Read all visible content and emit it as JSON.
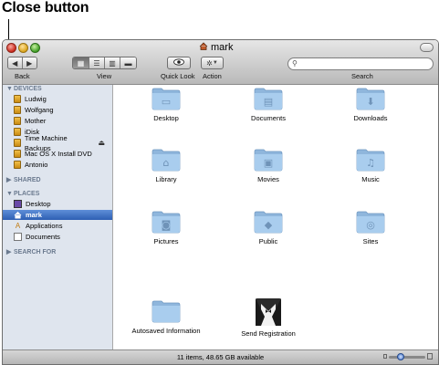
{
  "annotation": {
    "label": "Close button"
  },
  "window": {
    "title": "mark"
  },
  "toolbar": {
    "back_label": "Back",
    "view_label": "View",
    "quicklook_label": "Quick Look",
    "action_label": "Action",
    "search_label": "Search",
    "search_placeholder": ""
  },
  "sidebar": {
    "devices_header": "DEVICES",
    "devices": [
      "Ludwig",
      "Wolfgang",
      "Mother",
      "iDisk",
      "Time Machine Backups",
      "Mac OS X Install DVD",
      "Antonio"
    ],
    "shared_header": "SHARED",
    "places_header": "PLACES",
    "places": [
      "Desktop",
      "mark",
      "Applications",
      "Documents"
    ],
    "search_header": "SEARCH FOR"
  },
  "folders": [
    {
      "name": "Desktop",
      "icon": "desktop-folder-icon"
    },
    {
      "name": "Documents",
      "icon": "documents-folder-icon"
    },
    {
      "name": "Downloads",
      "icon": "downloads-folder-icon"
    },
    {
      "name": "Library",
      "icon": "library-folder-icon"
    },
    {
      "name": "Movies",
      "icon": "movies-folder-icon"
    },
    {
      "name": "Music",
      "icon": "music-folder-icon"
    },
    {
      "name": "Pictures",
      "icon": "pictures-folder-icon"
    },
    {
      "name": "Public",
      "icon": "public-folder-icon"
    },
    {
      "name": "Sites",
      "icon": "sites-folder-icon"
    },
    {
      "name": "Autosaved Information",
      "icon": "folder-icon"
    },
    {
      "name": "Send Registration",
      "icon": "tuxedo-app-icon"
    }
  ],
  "status": {
    "text": "11 items, 48.65 GB available"
  },
  "colors": {
    "selection": "#3b6cc7",
    "sidebar_bg": "#dfe5ee",
    "folder": "#9fc3e6"
  }
}
